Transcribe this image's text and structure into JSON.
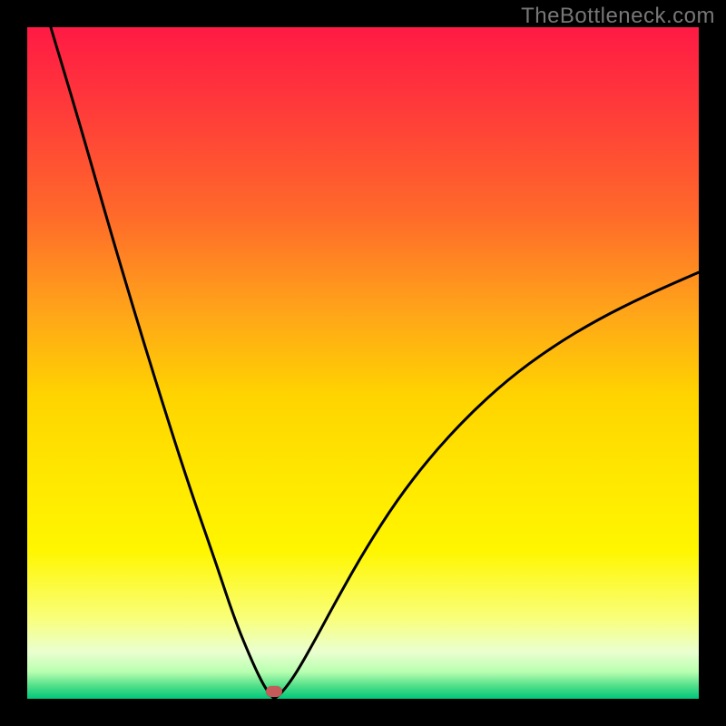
{
  "watermark": "TheBottleneck.com",
  "marker": {
    "x_pct": 36.8,
    "color": "#c45a5a"
  },
  "chart_data": {
    "type": "line",
    "title": "",
    "xlabel": "",
    "ylabel": "",
    "xlim": [
      0,
      100
    ],
    "ylim": [
      0,
      100
    ],
    "grid": false,
    "legend": false,
    "annotations": [
      "TheBottleneck.com"
    ],
    "description": "Bottleneck curve: height (y) represents mismatch severity on a red-to-green gradient; the minimum at x≈37 is the optimal balance point marked with a red pill.",
    "series": [
      {
        "name": "left-branch",
        "x": [
          3.5,
          8,
          12,
          16,
          20,
          24,
          28,
          31,
          33.5,
          35.2,
          36.2,
          36.8
        ],
        "values": [
          100,
          85,
          71,
          57.5,
          44.5,
          32,
          20.5,
          11.5,
          5.5,
          2,
          0.6,
          0
        ]
      },
      {
        "name": "right-branch",
        "x": [
          36.8,
          38,
          40,
          43,
          46.5,
          50.5,
          55,
          60,
          65.5,
          71.5,
          78,
          85,
          92,
          100
        ],
        "values": [
          0,
          1,
          3.7,
          9,
          15.5,
          22.5,
          29.5,
          36,
          42,
          47.5,
          52.3,
          56.5,
          60,
          63.5
        ]
      }
    ]
  }
}
